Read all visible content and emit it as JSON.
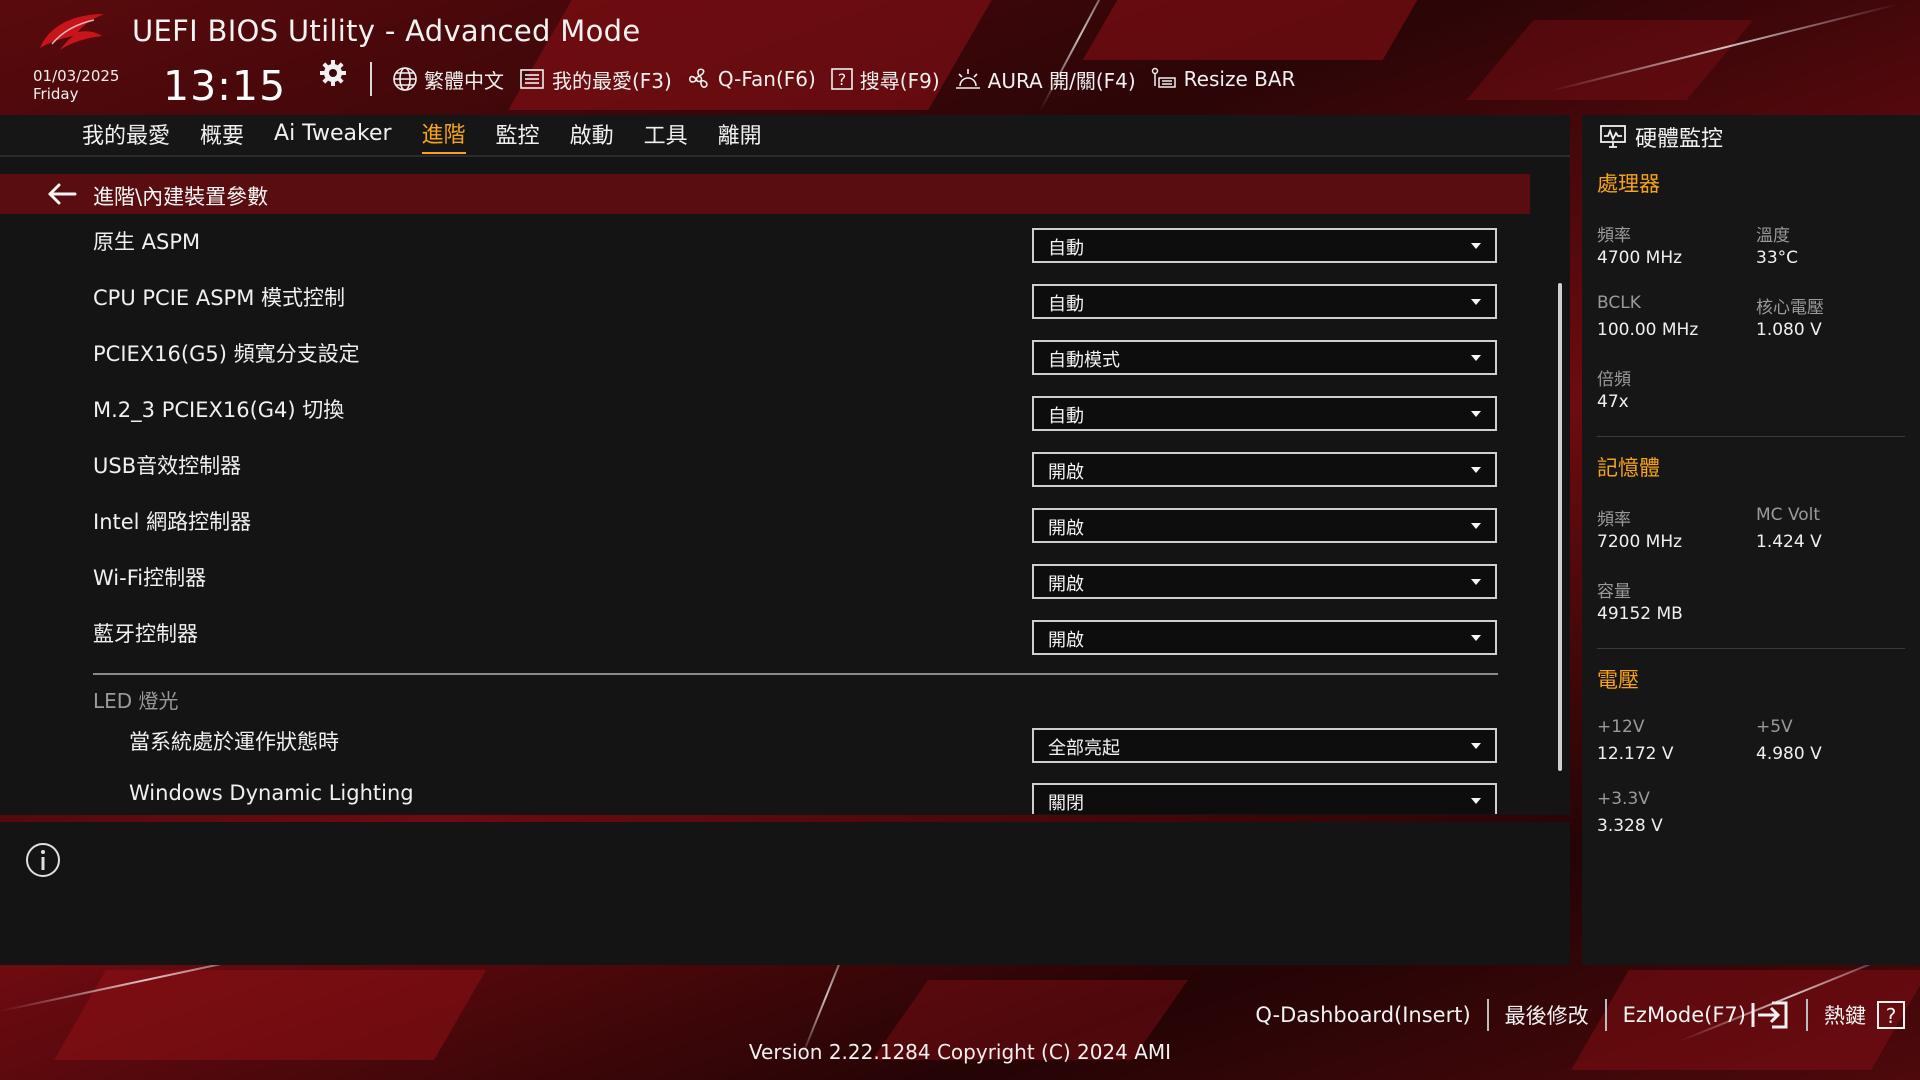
{
  "header": {
    "title": "UEFI BIOS Utility - Advanced Mode",
    "date": "01/03/2025",
    "weekday": "Friday",
    "time": "13:15",
    "tools": [
      {
        "icon": "globe-icon",
        "label": "繁體中文"
      },
      {
        "icon": "favorites-list-icon",
        "label": "我的最愛(F3)"
      },
      {
        "icon": "fan-icon",
        "label": "Q-Fan(F6)"
      },
      {
        "icon": "help-search-icon",
        "label": "搜尋(F9)"
      },
      {
        "icon": "aura-light-icon",
        "label": "AURA 開/關(F4)"
      },
      {
        "icon": "resize-bar-icon",
        "label": "Resize BAR"
      }
    ]
  },
  "nav": {
    "tabs": [
      "我的最愛",
      "概要",
      "Ai Tweaker",
      "進階",
      "監控",
      "啟動",
      "工具",
      "離開"
    ],
    "active_index": 3
  },
  "breadcrumb": "進階\\內建裝置參數",
  "settings": [
    {
      "label": "原生 ASPM",
      "value": "自動"
    },
    {
      "label": "CPU PCIE ASPM 模式控制",
      "value": "自動"
    },
    {
      "label": "PCIEX16(G5) 頻寬分支設定",
      "value": "自動模式"
    },
    {
      "label": "M.2_3 PCIEX16(G4) 切換",
      "value": "自動"
    },
    {
      "label": "USB音效控制器",
      "value": "開啟"
    },
    {
      "label": "Intel 網路控制器",
      "value": "開啟"
    },
    {
      "label": "Wi-Fi控制器",
      "value": "開啟"
    },
    {
      "label": "藍牙控制器",
      "value": "開啟"
    }
  ],
  "led_section": {
    "title": "LED 燈光",
    "items": [
      {
        "label": "當系統處於運作狀態時",
        "value": "全部亮起"
      },
      {
        "label": "Windows Dynamic Lighting",
        "value": "關閉"
      }
    ]
  },
  "hw_monitor": {
    "title": "硬體監控",
    "cpu": {
      "section": "處理器",
      "freq_label": "頻率",
      "freq": "4700 MHz",
      "temp_label": "溫度",
      "temp": "33°C",
      "bclk_label": "BCLK",
      "bclk": "100.00 MHz",
      "vcore_label": "核心電壓",
      "vcore": "1.080 V",
      "ratio_label": "倍頻",
      "ratio": "47x"
    },
    "memory": {
      "section": "記憶體",
      "freq_label": "頻率",
      "freq": "7200 MHz",
      "mcvolt_label": "MC Volt",
      "mcvolt": "1.424 V",
      "cap_label": "容量",
      "cap": "49152 MB"
    },
    "voltage": {
      "section": "電壓",
      "v12_label": "+12V",
      "v12": "12.172 V",
      "v5_label": "+5V",
      "v5": "4.980 V",
      "v33_label": "+3.3V",
      "v33": "3.328 V"
    }
  },
  "footer": {
    "qdashboard": "Q-Dashboard(Insert)",
    "last_modified": "最後修改",
    "ezmode": "EzMode(F7)",
    "hotkeys": "熱鍵",
    "version": "Version 2.22.1284 Copyright (C) 2024 AMI"
  },
  "colors": {
    "accent": "#f5a21c",
    "breadcrumb_bg": "#5a0d10",
    "panel_bg": "#141414"
  }
}
